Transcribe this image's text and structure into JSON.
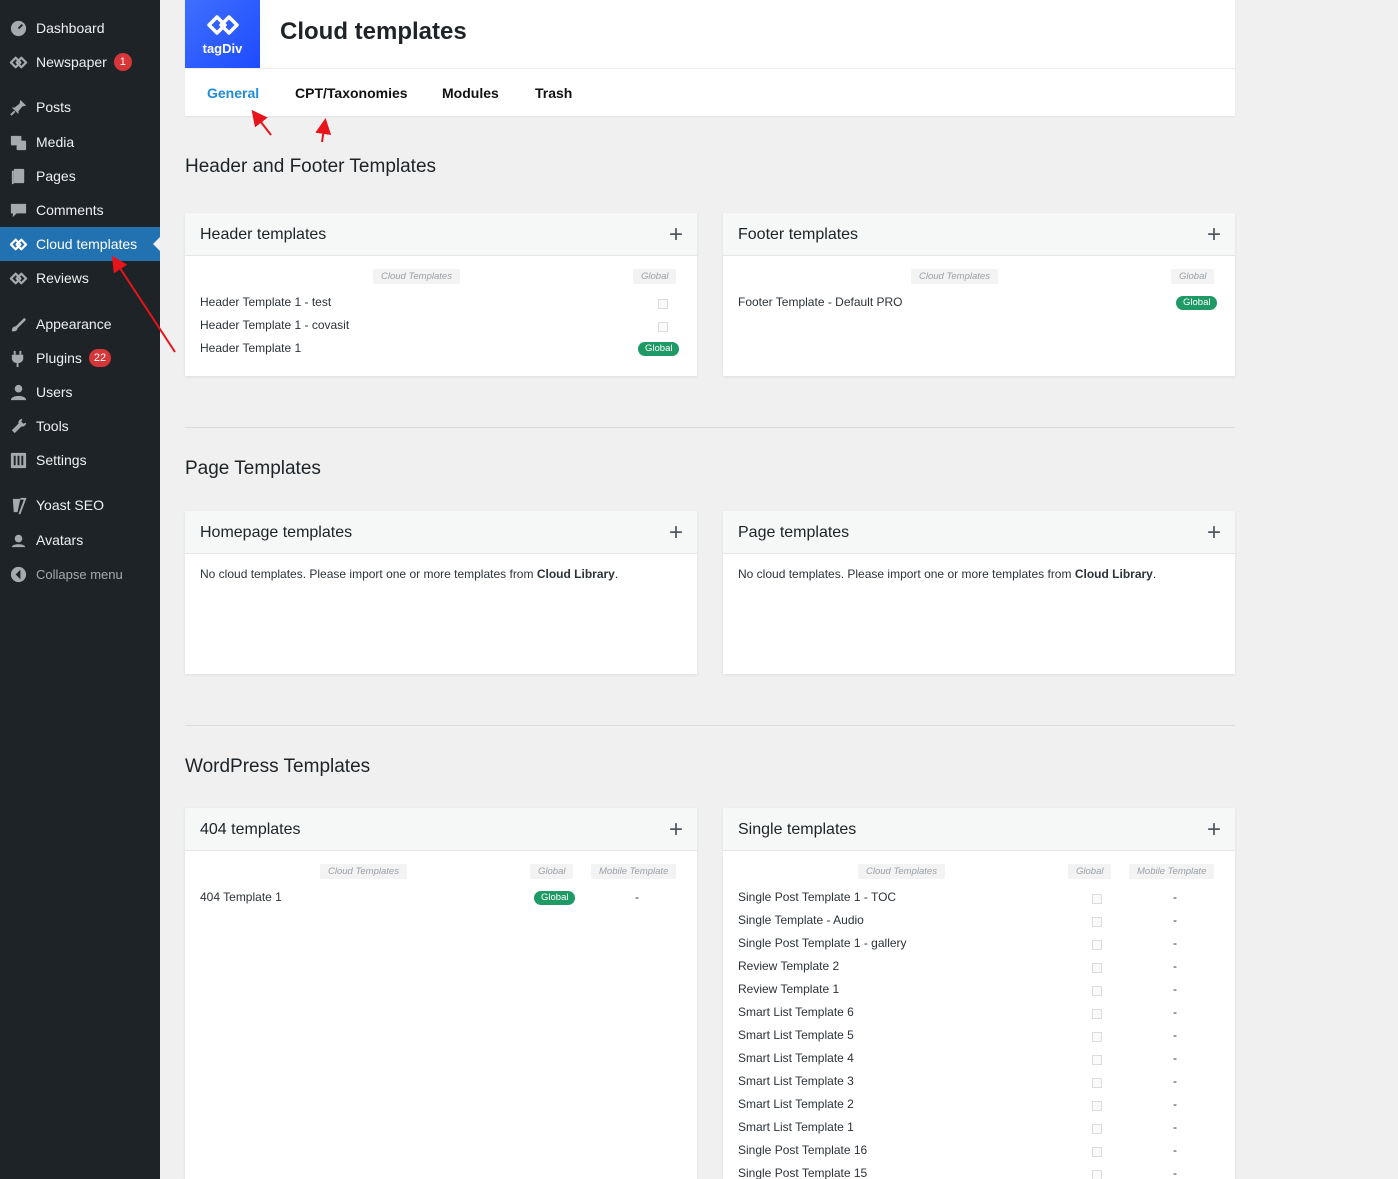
{
  "sidebar": {
    "items": [
      {
        "label": "Dashboard",
        "icon": "dashboard-icon"
      },
      {
        "label": "Newspaper",
        "icon": "tagdiv-icon",
        "count": "1"
      },
      {
        "label": "Posts",
        "icon": "pin-icon"
      },
      {
        "label": "Media",
        "icon": "media-icon"
      },
      {
        "label": "Pages",
        "icon": "page-icon"
      },
      {
        "label": "Comments",
        "icon": "comment-icon"
      },
      {
        "label": "Cloud templates",
        "icon": "tagdiv-icon"
      },
      {
        "label": "Reviews",
        "icon": "tagdiv-icon"
      },
      {
        "label": "Appearance",
        "icon": "brush-icon"
      },
      {
        "label": "Plugins",
        "icon": "plugin-icon",
        "count": "22"
      },
      {
        "label": "Users",
        "icon": "user-icon"
      },
      {
        "label": "Tools",
        "icon": "wrench-icon"
      },
      {
        "label": "Settings",
        "icon": "settings-icon"
      },
      {
        "label": "Yoast SEO",
        "icon": "yoast-icon"
      },
      {
        "label": "Avatars",
        "icon": "avatar-icon"
      },
      {
        "label": "Collapse menu",
        "icon": "collapse-icon"
      }
    ],
    "active_index": 6,
    "active_color": "#2271b1"
  },
  "header": {
    "logo_text": "tagDiv",
    "title": "Cloud templates",
    "tabs": [
      "General",
      "CPT/Taxonomies",
      "Modules",
      "Trash"
    ],
    "active_tab": "General",
    "accent": "#1e8cda"
  },
  "sections": [
    {
      "title": "Header and Footer Templates",
      "cards": [
        {
          "title": "Header templates",
          "columns": [
            "Cloud Templates",
            "Global"
          ],
          "rows": [
            {
              "name": "Header Template 1 - test",
              "global": false
            },
            {
              "name": "Header Template 1 - covasit",
              "global": false
            },
            {
              "name": "Header Template 1",
              "global": true
            }
          ]
        },
        {
          "title": "Footer templates",
          "columns": [
            "Cloud Templates",
            "Global"
          ],
          "rows": [
            {
              "name": "Footer Template - Default PRO",
              "global": true
            }
          ]
        }
      ]
    },
    {
      "title": "Page Templates",
      "cards": [
        {
          "title": "Homepage templates",
          "empty_text": "No cloud templates. Please import one or more templates from ",
          "empty_link": "Cloud Library",
          "empty_end": "."
        },
        {
          "title": "Page templates",
          "empty_text": "No cloud templates. Please import one or more templates from ",
          "empty_link": "Cloud Library",
          "empty_end": "."
        }
      ]
    },
    {
      "title": "WordPress Templates",
      "cards": [
        {
          "title": "404 templates",
          "columns": [
            "Cloud Templates",
            "Global",
            "Mobile Template"
          ],
          "rows": [
            {
              "name": "404 Template 1",
              "global": true,
              "mobile": "-"
            }
          ]
        },
        {
          "title": "Single templates",
          "columns": [
            "Cloud Templates",
            "Global",
            "Mobile Template"
          ],
          "rows": [
            {
              "name": "Single Post Template 1 - TOC",
              "global": false,
              "mobile": "-"
            },
            {
              "name": "Single Template - Audio",
              "global": false,
              "mobile": "-"
            },
            {
              "name": "Single Post Template 1 - gallery",
              "global": false,
              "mobile": "-"
            },
            {
              "name": "Review Template 2",
              "global": false,
              "mobile": "-"
            },
            {
              "name": "Review Template 1",
              "global": false,
              "mobile": "-"
            },
            {
              "name": "Smart List Template 6",
              "global": false,
              "mobile": "-"
            },
            {
              "name": "Smart List Template 5",
              "global": false,
              "mobile": "-"
            },
            {
              "name": "Smart List Template 4",
              "global": false,
              "mobile": "-"
            },
            {
              "name": "Smart List Template 3",
              "global": false,
              "mobile": "-"
            },
            {
              "name": "Smart List Template 2",
              "global": false,
              "mobile": "-"
            },
            {
              "name": "Smart List Template 1",
              "global": false,
              "mobile": "-"
            },
            {
              "name": "Single Post Template 16",
              "global": false,
              "mobile": "-"
            },
            {
              "name": "Single Post Template 15",
              "global": false,
              "mobile": "-"
            }
          ]
        }
      ]
    }
  ],
  "badge_label": "Global",
  "badge_color": "#1f9966",
  "annotation_color": "#e8141b"
}
